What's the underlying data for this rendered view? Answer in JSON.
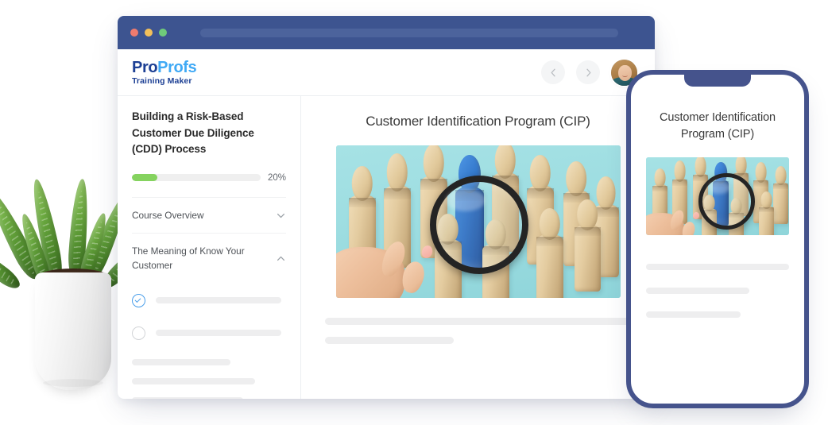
{
  "browser": {
    "titlebar": {
      "dots": [
        "close-red",
        "minimize-yellow",
        "maximize-green"
      ],
      "address_value": ""
    }
  },
  "app": {
    "logo": {
      "part1": "Pro",
      "part2": "Profs",
      "tagline": "Training Maker",
      "color_dark": "#1c3f94",
      "color_light": "#3fa9f5"
    },
    "nav": {
      "prev_label": "‹",
      "next_label": "›"
    }
  },
  "sidebar": {
    "course_title": "Building a Risk-Based Customer Due Diligence (CDD) Process",
    "progress": {
      "percent": 20,
      "label": "20%",
      "fill_color": "#85d35f",
      "track_color": "#efefef"
    },
    "sections": [
      {
        "label": "Course Overview",
        "expanded": false,
        "chevron": "chevron-down-icon"
      },
      {
        "label": "The Meaning of Know Your Customer",
        "expanded": true,
        "chevron": "chevron-up-icon"
      }
    ],
    "lessons": [
      {
        "status": "completed",
        "icon": "check-circle-icon",
        "title": ""
      },
      {
        "status": "pending",
        "icon": "empty-circle-icon",
        "title": ""
      }
    ],
    "placeholder_widths": [
      "64%",
      "80%",
      "72%"
    ]
  },
  "main": {
    "slide_title": "Customer Identification Program (CIP)",
    "hero_image": {
      "alt": "magnifying-glass-over-blue-wooden-figure",
      "background": "#9ddde1"
    },
    "placeholder_widths": [
      "100%",
      "42%"
    ]
  },
  "phone": {
    "frame_color": "#45538c",
    "slide_title": "Customer Identification Program (CIP)",
    "hero_image": {
      "alt": "magnifying-glass-over-blue-wooden-figure",
      "background": "#9ddde1"
    },
    "placeholder_widths": [
      "100%",
      "72%",
      "66%"
    ]
  },
  "decoration": {
    "plant": "potted-succulent-aloe"
  }
}
